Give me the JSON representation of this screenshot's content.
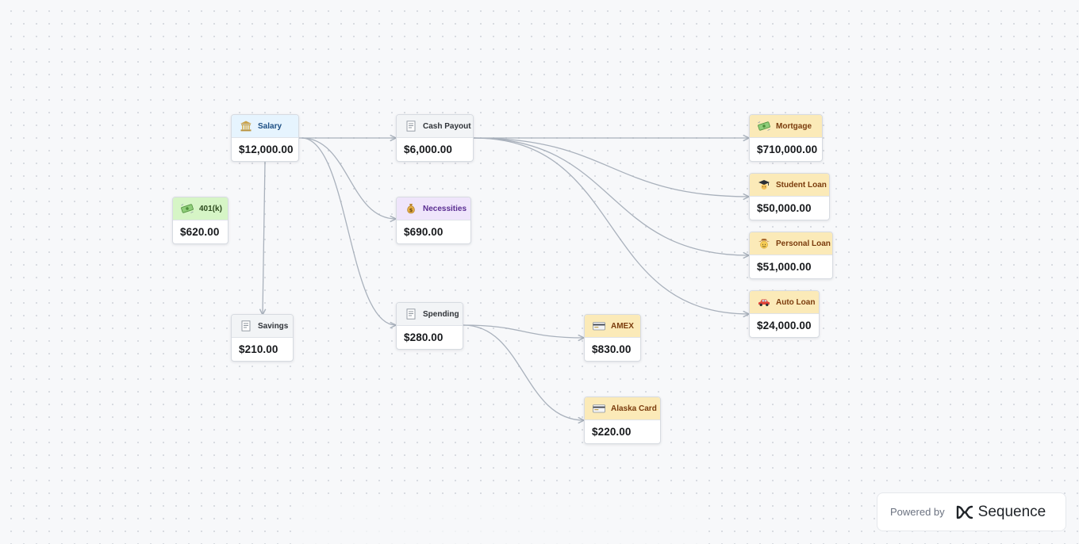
{
  "nodes": {
    "salary": {
      "label": "Salary",
      "amount": "$12,000.00",
      "icon": "bank-icon"
    },
    "cash_payout": {
      "label": "Cash Payout",
      "amount": "$6,000.00",
      "icon": "receipt-icon"
    },
    "k401": {
      "label": "401(k)",
      "amount": "$620.00",
      "icon": "flying-money-icon"
    },
    "necessities": {
      "label": "Necessities",
      "amount": "$690.00",
      "icon": "money-bag-icon"
    },
    "savings": {
      "label": "Savings",
      "amount": "$210.00",
      "icon": "receipt-icon"
    },
    "spending": {
      "label": "Spending",
      "amount": "$280.00",
      "icon": "receipt-icon"
    },
    "mortgage": {
      "label": "Mortgage",
      "amount": "$710,000.00",
      "icon": "flying-money-icon"
    },
    "student_loan": {
      "label": "Student Loan",
      "amount": "$50,000.00",
      "icon": "graduation-cap-icon"
    },
    "personal_loan": {
      "label": "Personal Loan",
      "amount": "$51,000.00",
      "icon": "cowboy-face-icon"
    },
    "auto_loan": {
      "label": "Auto Loan",
      "amount": "$24,000.00",
      "icon": "car-icon"
    },
    "amex": {
      "label": "AMEX",
      "amount": "$830.00",
      "icon": "credit-card-icon"
    },
    "alaska_card": {
      "label": "Alaska Card",
      "amount": "$220.00",
      "icon": "credit-card-icon"
    }
  },
  "connections": [
    {
      "from": "salary",
      "to": "cash_payout"
    },
    {
      "from": "salary",
      "to": "necessities"
    },
    {
      "from": "salary",
      "to": "spending"
    },
    {
      "from": "salary",
      "to": "savings"
    },
    {
      "from": "cash_payout",
      "to": "mortgage"
    },
    {
      "from": "cash_payout",
      "to": "student_loan"
    },
    {
      "from": "cash_payout",
      "to": "personal_loan"
    },
    {
      "from": "cash_payout",
      "to": "auto_loan"
    },
    {
      "from": "spending",
      "to": "amex"
    },
    {
      "from": "spending",
      "to": "alaska_card"
    }
  ],
  "colors": {
    "edge": "#a9b1bc",
    "income_header": "#e6f4fe",
    "pod_header": "#f2f4f6",
    "retirement_header": "#d6f5c6",
    "necessities_header": "#efe5fb",
    "liability_header": "#fbeab8"
  },
  "footer": {
    "powered_by": "Powered by",
    "brand": "Sequence"
  }
}
